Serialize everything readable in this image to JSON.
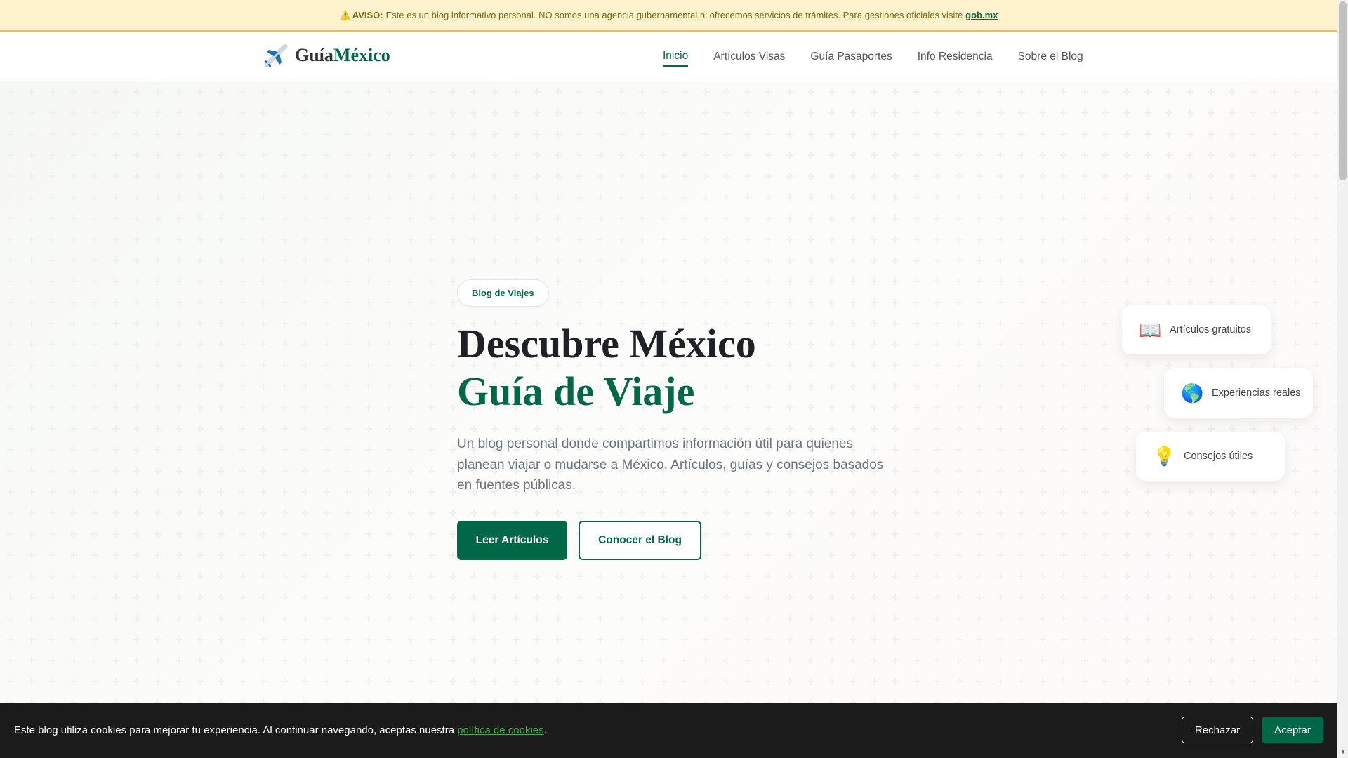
{
  "banner": {
    "icon": "warning-icon",
    "glyph": "⚠️",
    "label": "AVISO:",
    "text": "Este es un blog informativo personal. NO somos una agencia gubernamental ni ofrecemos servicios de trámites. Para gestiones oficiales visite",
    "link": "gob.mx"
  },
  "header": {
    "logo_icon": "airplane-icon",
    "logo_part1": "Guía",
    "logo_part2": "México",
    "nav": [
      {
        "label": "Inicio"
      },
      {
        "label": "Artículos Visas"
      },
      {
        "label": "Guía Pasaportes"
      },
      {
        "label": "Info Residencia"
      },
      {
        "label": "Sobre el Blog"
      }
    ]
  },
  "hero": {
    "badge": "Blog de Viajes",
    "title_line1": "Descubre México",
    "title_line2": "Guía de Viaje",
    "lead": "Un blog personal donde compartimos información útil para quienes planean viajar o mudarse a México. Artículos, guías y consejos basados en fuentes públicas.",
    "primary_button": "Leer Artículos",
    "secondary_button": "Conocer el Blog"
  },
  "features": [
    {
      "icon": "📖",
      "label": "Artículos gratuitos"
    },
    {
      "icon": "🌎",
      "label": "Experiencias reales"
    },
    {
      "icon": "💡",
      "label": "Consejos útiles"
    }
  ],
  "cookie": {
    "text": "Este blog utiliza cookies para mejorar tu experiencia. Al continuar navegando, aceptas nuestra",
    "link": "política de cookies",
    "end": ".",
    "reject": "Rechazar",
    "accept": "Aceptar"
  },
  "colors": {
    "brand": "#006847",
    "banner_bg": "#fff3cd",
    "cookie_bg": "#1b1b1b"
  }
}
